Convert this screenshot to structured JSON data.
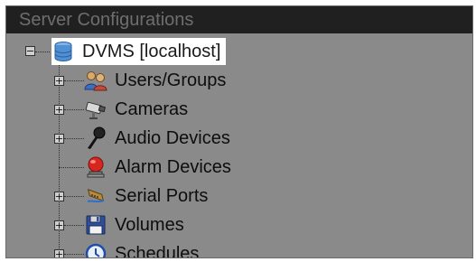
{
  "panel": {
    "title": "Server Configurations"
  },
  "tree": {
    "root": {
      "label": "DVMS [localhost]",
      "icon": "database-icon",
      "expanded": true
    },
    "children": [
      {
        "label": "Users/Groups",
        "icon": "users-icon",
        "expander": "+"
      },
      {
        "label": "Cameras",
        "icon": "camera-icon",
        "expander": "+"
      },
      {
        "label": "Audio Devices",
        "icon": "microphone-icon",
        "expander": "+"
      },
      {
        "label": "Alarm Devices",
        "icon": "alarm-icon",
        "expander": ""
      },
      {
        "label": "Serial Ports",
        "icon": "serial-port-icon",
        "expander": "+"
      },
      {
        "label": "Volumes",
        "icon": "floppy-disk-icon",
        "expander": "+"
      },
      {
        "label": "Schedules",
        "icon": "clock-icon",
        "expander": "+"
      }
    ]
  },
  "root_expander": "−"
}
